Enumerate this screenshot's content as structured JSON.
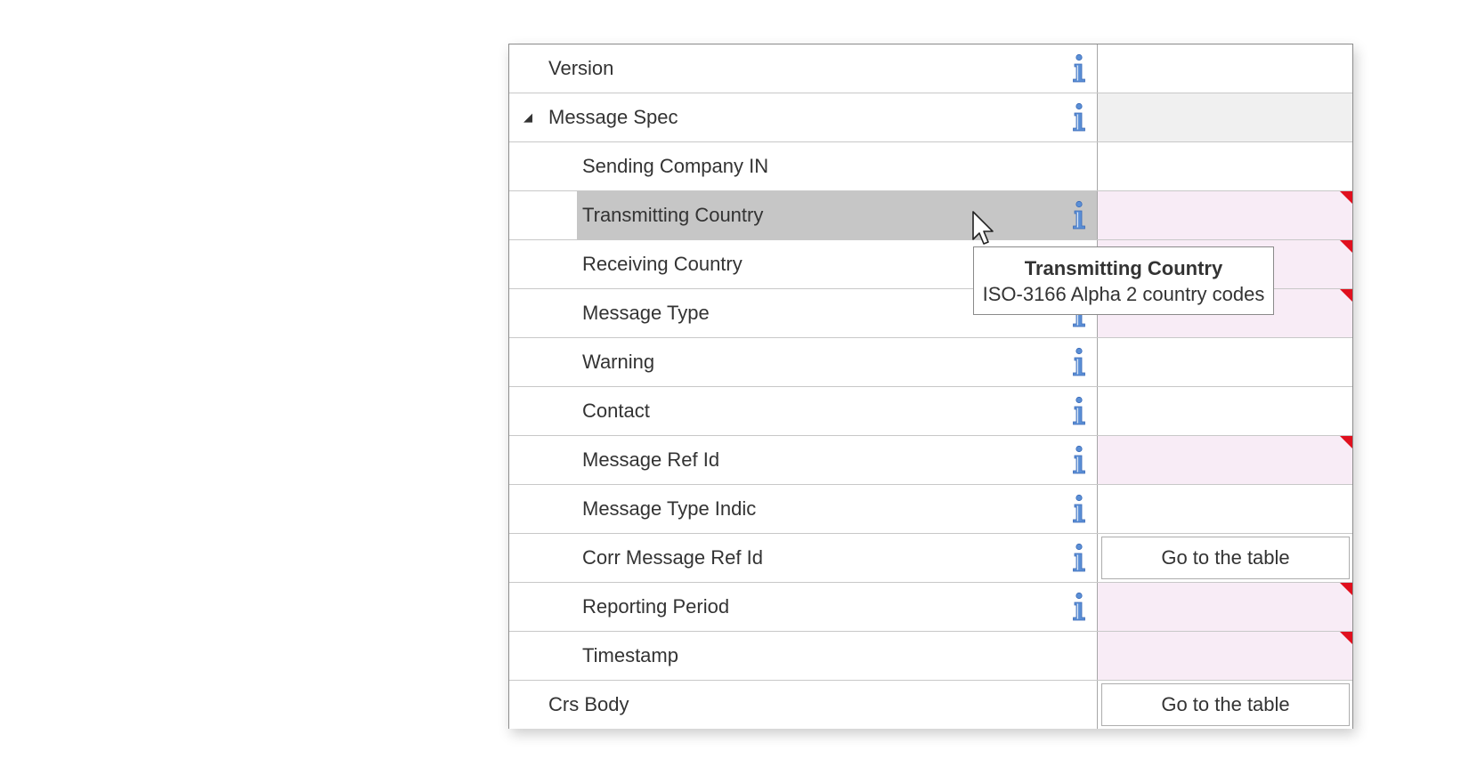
{
  "rows": [
    {
      "label": "Version",
      "level": 0,
      "info": true,
      "value": "plain"
    },
    {
      "label": "Message Spec",
      "level": 0,
      "expander": "◢",
      "info": true,
      "value": "gray"
    },
    {
      "label": "Sending Company IN",
      "level": 1,
      "info": false,
      "value": "plain"
    },
    {
      "label": "Transmitting Country",
      "level": 1,
      "info": true,
      "value": "invalid",
      "selected": true
    },
    {
      "label": "Receiving Country",
      "level": 1,
      "info": true,
      "value": "invalid"
    },
    {
      "label": "Message Type",
      "level": 1,
      "info": true,
      "value": "invalid"
    },
    {
      "label": "Warning",
      "level": 1,
      "info": true,
      "value": "plain"
    },
    {
      "label": "Contact",
      "level": 1,
      "info": true,
      "value": "plain"
    },
    {
      "label": "Message Ref Id",
      "level": 1,
      "info": true,
      "value": "invalid"
    },
    {
      "label": "Message Type Indic",
      "level": 1,
      "info": true,
      "value": "plain"
    },
    {
      "label": "Corr Message Ref Id",
      "level": 1,
      "info": true,
      "value": "button",
      "button_label": "Go to the table"
    },
    {
      "label": "Reporting Period",
      "level": 1,
      "info": true,
      "value": "invalid"
    },
    {
      "label": "Timestamp",
      "level": 1,
      "info": false,
      "value": "invalid"
    },
    {
      "label": "Crs Body",
      "level": 0,
      "info": false,
      "value": "button",
      "button_label": "Go to the table"
    }
  ],
  "tooltip": {
    "title": "Transmitting Country",
    "body": "ISO-3166 Alpha 2 country codes"
  },
  "colors": {
    "selected_row": "#c6c6c6",
    "invalid_value": "#f8ecf6",
    "error_marker": "#e0101e",
    "info_icon": "#5b8fd6",
    "group_value": "#f0f0f0"
  },
  "icons": {
    "info": "info-icon",
    "expander": "collapse-triangle-icon",
    "error": "error-corner-icon",
    "cursor": "mouse-pointer-icon"
  }
}
